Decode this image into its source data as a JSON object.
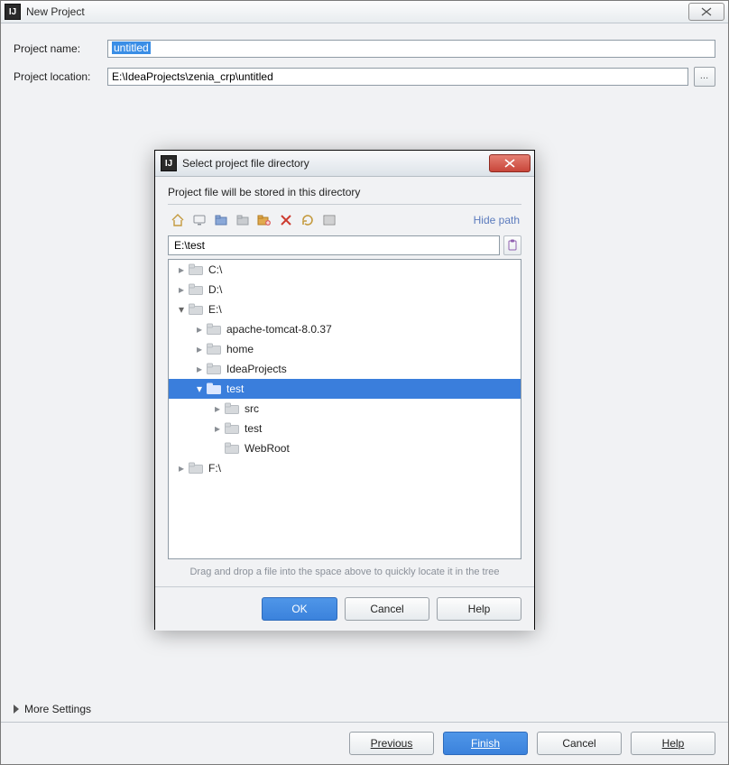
{
  "outer": {
    "title": "New Project",
    "form": {
      "name_label": "Project name:",
      "name_value": "untitled",
      "location_label": "Project location:",
      "location_value": "E:\\IdeaProjects\\zenia_crp\\untitled",
      "browse_label": "…"
    },
    "more_settings": "More Settings",
    "buttons": {
      "previous": "Previous",
      "finish": "Finish",
      "cancel": "Cancel",
      "help": "Help"
    }
  },
  "dialog": {
    "title": "Select project file directory",
    "subtitle": "Project file will be stored in this directory",
    "hide_path": "Hide path",
    "path_value": "E:\\test",
    "toolbar": {
      "home": "home-icon",
      "desktop": "desktop-icon",
      "project": "project-icon",
      "module": "module-icon",
      "newfolder": "new-folder-icon",
      "delete": "delete-icon",
      "refresh": "refresh-icon",
      "showhidden": "show-hidden-icon"
    },
    "tree": [
      {
        "depth": 0,
        "expand": "right",
        "label": "C:\\"
      },
      {
        "depth": 0,
        "expand": "right",
        "label": "D:\\"
      },
      {
        "depth": 0,
        "expand": "down",
        "label": "E:\\"
      },
      {
        "depth": 1,
        "expand": "right",
        "label": "apache-tomcat-8.0.37"
      },
      {
        "depth": 1,
        "expand": "right",
        "label": "home"
      },
      {
        "depth": 1,
        "expand": "right",
        "label": "IdeaProjects"
      },
      {
        "depth": 1,
        "expand": "down",
        "label": "test",
        "selected": true
      },
      {
        "depth": 2,
        "expand": "right",
        "label": "src"
      },
      {
        "depth": 2,
        "expand": "right",
        "label": "test"
      },
      {
        "depth": 2,
        "expand": "none",
        "label": "WebRoot"
      },
      {
        "depth": 0,
        "expand": "right",
        "label": "F:\\"
      }
    ],
    "drop_hint": "Drag and drop a file into the space above to quickly locate it in the tree",
    "buttons": {
      "ok": "OK",
      "cancel": "Cancel",
      "help": "Help"
    }
  }
}
